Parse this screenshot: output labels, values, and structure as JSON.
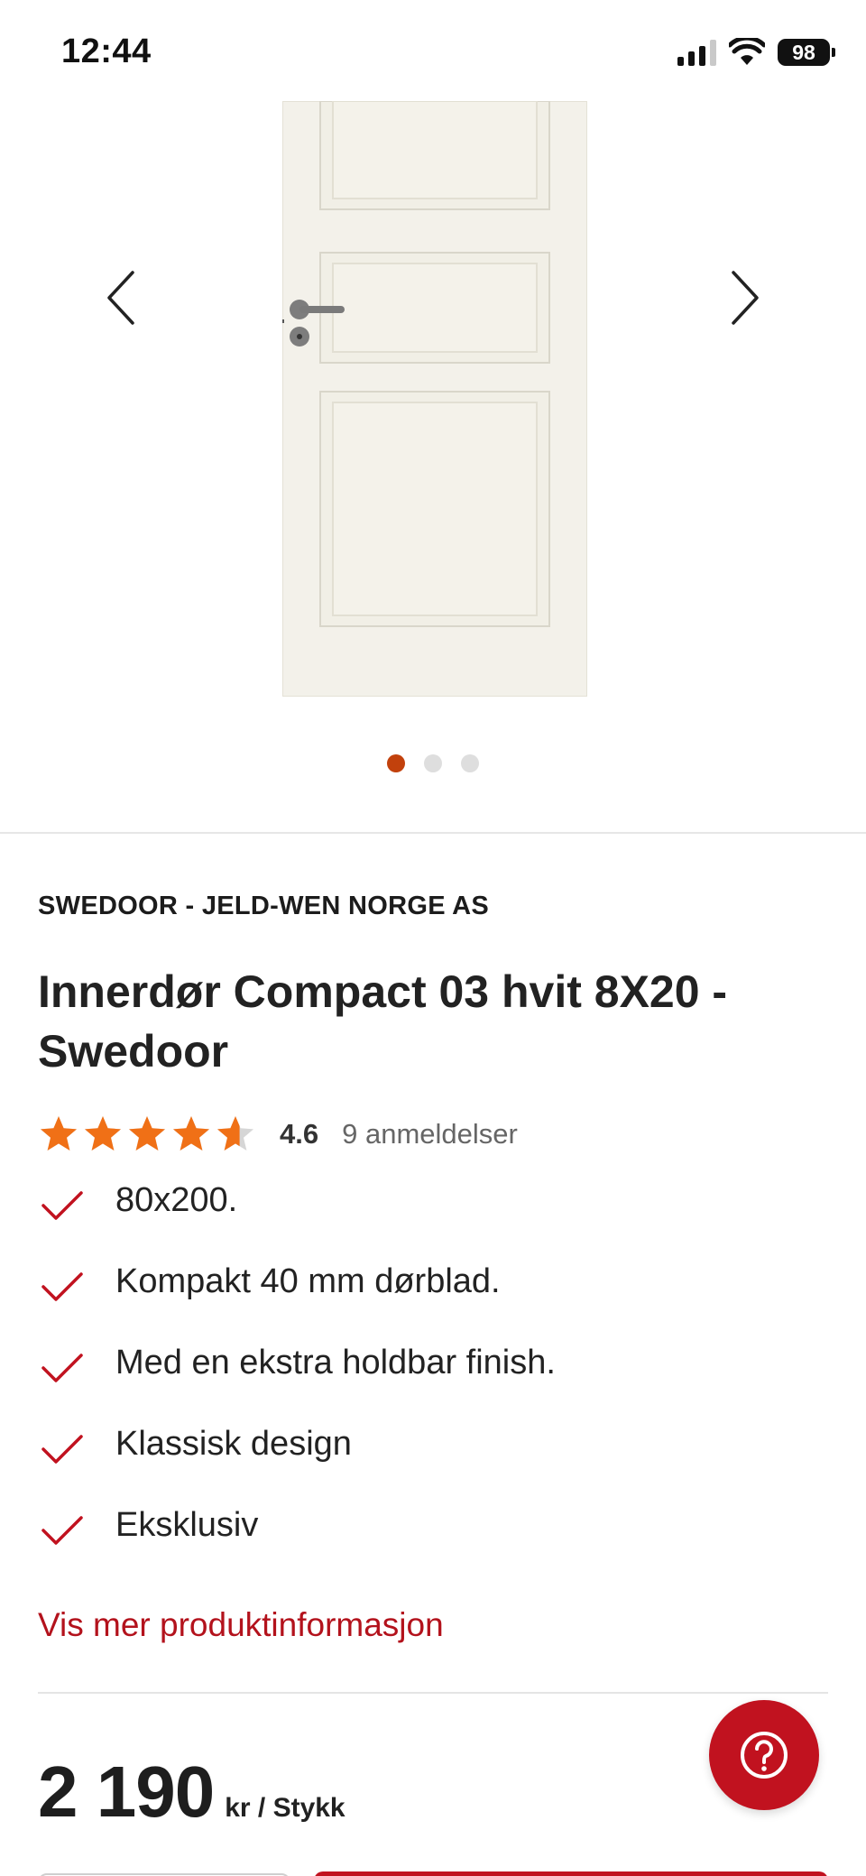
{
  "status_bar": {
    "time": "12:44",
    "battery": "98",
    "icons": [
      "cellular-signal-icon",
      "wifi-icon",
      "battery-icon"
    ]
  },
  "gallery": {
    "image": "door-image",
    "prev_icon": "chevron-left-icon",
    "next_icon": "chevron-right-icon",
    "slide_count": 3,
    "active_slide": 1
  },
  "product": {
    "brand": "SWEDOOR - JELD-WEN NORGE AS",
    "title": "Innerdør Compact 03 hvit 8X20 - Swedoor",
    "rating": {
      "value": "4.6",
      "stars": 4.6,
      "max_stars": 5,
      "count_label": "9 anmeldelser"
    },
    "features": [
      "80x200.",
      "Kompakt 40 mm dørblad.",
      "Med en ekstra holdbar finish.",
      "Klassisk design",
      "Eksklusiv"
    ],
    "more_info_link": "Vis mer produktinformasjon",
    "price": {
      "value": "2 190",
      "unit": "kr / Stykk"
    }
  },
  "help_button": {
    "icon": "question-mark-icon"
  },
  "colors": {
    "accent_red": "#c1121f",
    "link_red": "#b3121c",
    "star_orange": "#f07016",
    "active_dot": "#c2410c"
  }
}
